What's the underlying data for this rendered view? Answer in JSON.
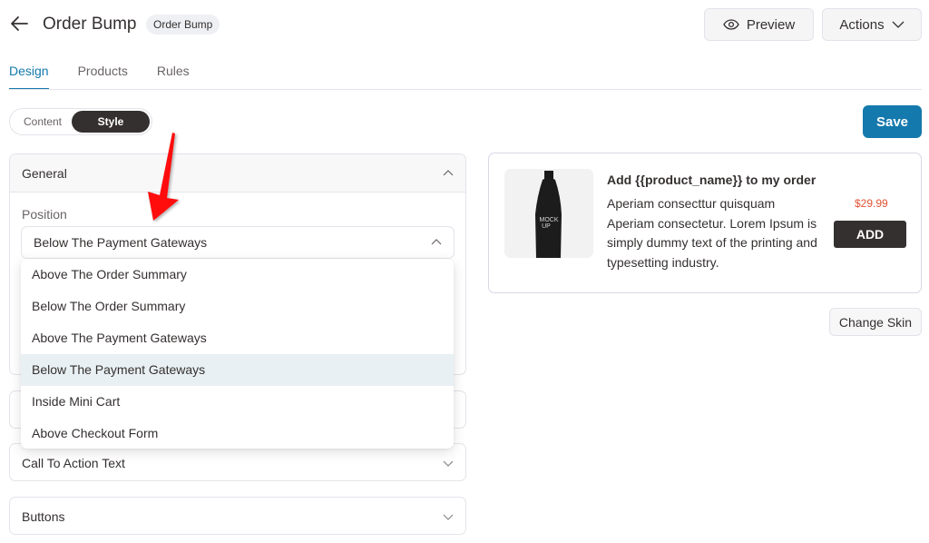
{
  "header": {
    "back_icon": "arrow-left-icon",
    "title": "Order Bump",
    "badge": "Order Bump",
    "preview_label": "Preview",
    "preview_icon": "eye-icon",
    "actions_label": "Actions",
    "actions_icon": "chevron-down-icon"
  },
  "tabs": [
    {
      "label": "Design",
      "active": true
    },
    {
      "label": "Products",
      "active": false
    },
    {
      "label": "Rules",
      "active": false
    }
  ],
  "mode_toggle": {
    "options": [
      "Content",
      "Style"
    ],
    "selected": "Style"
  },
  "save_label": "Save",
  "panels": {
    "general": {
      "title": "General",
      "expanded": true,
      "position_label": "Position",
      "position_value": "Below The Payment Gateways",
      "dropdown_open": true,
      "options": [
        "Above The Order Summary",
        "Below The Order Summary",
        "Above The Payment Gateways",
        "Below The Payment Gateways",
        "Inside Mini Cart",
        "Above Checkout Form"
      ],
      "selected_index": 3
    },
    "cta": {
      "title": "Call To Action Text",
      "expanded": false
    },
    "buttons": {
      "title": "Buttons",
      "expanded": false
    }
  },
  "preview": {
    "title": "Add {{product_name}} to my order",
    "description": "Aperiam consecttur quisquam Aperiam consectetur. Lorem Ipsum is simply dummy text of the printing and typesetting industry.",
    "price": "$29.99",
    "add_label": "ADD",
    "product_image_text": "MOCK UP",
    "change_skin_label": "Change Skin"
  },
  "colors": {
    "accent": "#1479ad",
    "dark": "#353030",
    "price": "#e15334",
    "annotation_arrow": "#ff0000"
  }
}
